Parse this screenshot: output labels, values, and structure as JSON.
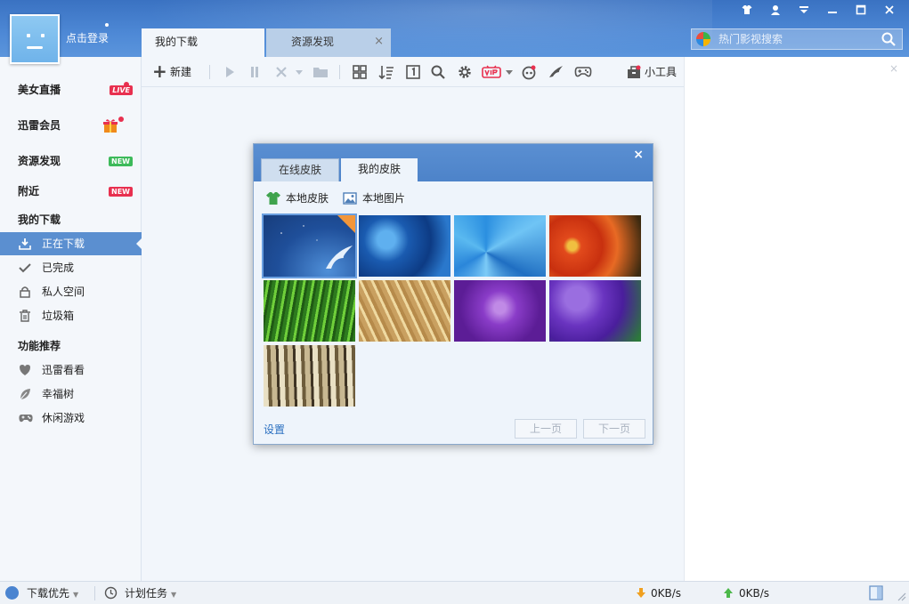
{
  "header": {
    "login_text": "点击登录",
    "tabs": [
      {
        "label": "我的下载"
      },
      {
        "label": "资源发现"
      }
    ],
    "tab_close": "×",
    "search_placeholder": "热门影视搜索",
    "window_controls": [
      "skin-icon",
      "user-icon",
      "menu-icon",
      "minimize-icon",
      "maximize-icon",
      "close-icon"
    ]
  },
  "sidebar": {
    "items": [
      {
        "label": "美女直播",
        "badge": "LIVE"
      },
      {
        "label": "迅雷会员"
      },
      {
        "label": "资源发现",
        "badge": "NEW"
      },
      {
        "label": "附近",
        "badge": "NEW"
      }
    ],
    "section_downloads": "我的下载",
    "downloads": [
      {
        "label": "正在下载",
        "active": true
      },
      {
        "label": "已完成"
      },
      {
        "label": "私人空间"
      },
      {
        "label": "垃圾箱"
      }
    ],
    "section_features": "功能推荐",
    "features": [
      {
        "label": "迅雷看看"
      },
      {
        "label": "幸福树"
      },
      {
        "label": "休闲游戏"
      }
    ]
  },
  "toolbar": {
    "new_label": "新建",
    "tools_label": "小工具"
  },
  "dialog": {
    "close": "×",
    "tabs": [
      {
        "label": "在线皮肤"
      },
      {
        "label": "我的皮肤",
        "active": true
      }
    ],
    "local_skin": "本地皮肤",
    "local_image": "本地图片",
    "settings": "设置",
    "prev_page": "上一页",
    "next_page": "下一页"
  },
  "statusbar": {
    "priority": "下载优先",
    "schedule": "计划任务",
    "down_speed": "0KB/s",
    "up_speed": "0KB/s"
  },
  "colors": {
    "header_blue": "#4a84d0",
    "active_item": "#5b8fd0",
    "badge_red": "#e8304f",
    "badge_green": "#3dba5a"
  }
}
